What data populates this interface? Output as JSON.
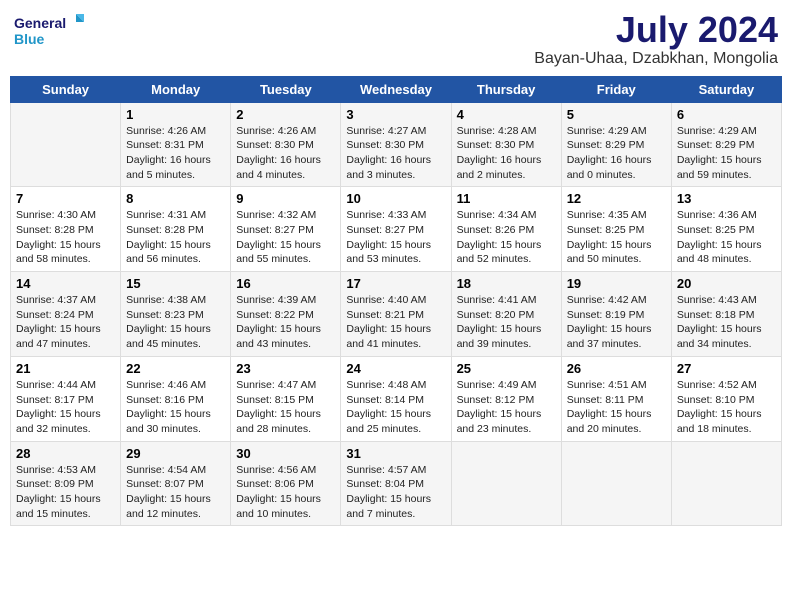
{
  "header": {
    "logo_line1": "General",
    "logo_line2": "Blue",
    "month_year": "July 2024",
    "location": "Bayan-Uhaa, Dzabkhan, Mongolia"
  },
  "weekdays": [
    "Sunday",
    "Monday",
    "Tuesday",
    "Wednesday",
    "Thursday",
    "Friday",
    "Saturday"
  ],
  "weeks": [
    [
      {
        "day": "",
        "info": ""
      },
      {
        "day": "1",
        "info": "Sunrise: 4:26 AM\nSunset: 8:31 PM\nDaylight: 16 hours\nand 5 minutes."
      },
      {
        "day": "2",
        "info": "Sunrise: 4:26 AM\nSunset: 8:30 PM\nDaylight: 16 hours\nand 4 minutes."
      },
      {
        "day": "3",
        "info": "Sunrise: 4:27 AM\nSunset: 8:30 PM\nDaylight: 16 hours\nand 3 minutes."
      },
      {
        "day": "4",
        "info": "Sunrise: 4:28 AM\nSunset: 8:30 PM\nDaylight: 16 hours\nand 2 minutes."
      },
      {
        "day": "5",
        "info": "Sunrise: 4:29 AM\nSunset: 8:29 PM\nDaylight: 16 hours\nand 0 minutes."
      },
      {
        "day": "6",
        "info": "Sunrise: 4:29 AM\nSunset: 8:29 PM\nDaylight: 15 hours\nand 59 minutes."
      }
    ],
    [
      {
        "day": "7",
        "info": "Sunrise: 4:30 AM\nSunset: 8:28 PM\nDaylight: 15 hours\nand 58 minutes."
      },
      {
        "day": "8",
        "info": "Sunrise: 4:31 AM\nSunset: 8:28 PM\nDaylight: 15 hours\nand 56 minutes."
      },
      {
        "day": "9",
        "info": "Sunrise: 4:32 AM\nSunset: 8:27 PM\nDaylight: 15 hours\nand 55 minutes."
      },
      {
        "day": "10",
        "info": "Sunrise: 4:33 AM\nSunset: 8:27 PM\nDaylight: 15 hours\nand 53 minutes."
      },
      {
        "day": "11",
        "info": "Sunrise: 4:34 AM\nSunset: 8:26 PM\nDaylight: 15 hours\nand 52 minutes."
      },
      {
        "day": "12",
        "info": "Sunrise: 4:35 AM\nSunset: 8:25 PM\nDaylight: 15 hours\nand 50 minutes."
      },
      {
        "day": "13",
        "info": "Sunrise: 4:36 AM\nSunset: 8:25 PM\nDaylight: 15 hours\nand 48 minutes."
      }
    ],
    [
      {
        "day": "14",
        "info": "Sunrise: 4:37 AM\nSunset: 8:24 PM\nDaylight: 15 hours\nand 47 minutes."
      },
      {
        "day": "15",
        "info": "Sunrise: 4:38 AM\nSunset: 8:23 PM\nDaylight: 15 hours\nand 45 minutes."
      },
      {
        "day": "16",
        "info": "Sunrise: 4:39 AM\nSunset: 8:22 PM\nDaylight: 15 hours\nand 43 minutes."
      },
      {
        "day": "17",
        "info": "Sunrise: 4:40 AM\nSunset: 8:21 PM\nDaylight: 15 hours\nand 41 minutes."
      },
      {
        "day": "18",
        "info": "Sunrise: 4:41 AM\nSunset: 8:20 PM\nDaylight: 15 hours\nand 39 minutes."
      },
      {
        "day": "19",
        "info": "Sunrise: 4:42 AM\nSunset: 8:19 PM\nDaylight: 15 hours\nand 37 minutes."
      },
      {
        "day": "20",
        "info": "Sunrise: 4:43 AM\nSunset: 8:18 PM\nDaylight: 15 hours\nand 34 minutes."
      }
    ],
    [
      {
        "day": "21",
        "info": "Sunrise: 4:44 AM\nSunset: 8:17 PM\nDaylight: 15 hours\nand 32 minutes."
      },
      {
        "day": "22",
        "info": "Sunrise: 4:46 AM\nSunset: 8:16 PM\nDaylight: 15 hours\nand 30 minutes."
      },
      {
        "day": "23",
        "info": "Sunrise: 4:47 AM\nSunset: 8:15 PM\nDaylight: 15 hours\nand 28 minutes."
      },
      {
        "day": "24",
        "info": "Sunrise: 4:48 AM\nSunset: 8:14 PM\nDaylight: 15 hours\nand 25 minutes."
      },
      {
        "day": "25",
        "info": "Sunrise: 4:49 AM\nSunset: 8:12 PM\nDaylight: 15 hours\nand 23 minutes."
      },
      {
        "day": "26",
        "info": "Sunrise: 4:51 AM\nSunset: 8:11 PM\nDaylight: 15 hours\nand 20 minutes."
      },
      {
        "day": "27",
        "info": "Sunrise: 4:52 AM\nSunset: 8:10 PM\nDaylight: 15 hours\nand 18 minutes."
      }
    ],
    [
      {
        "day": "28",
        "info": "Sunrise: 4:53 AM\nSunset: 8:09 PM\nDaylight: 15 hours\nand 15 minutes."
      },
      {
        "day": "29",
        "info": "Sunrise: 4:54 AM\nSunset: 8:07 PM\nDaylight: 15 hours\nand 12 minutes."
      },
      {
        "day": "30",
        "info": "Sunrise: 4:56 AM\nSunset: 8:06 PM\nDaylight: 15 hours\nand 10 minutes."
      },
      {
        "day": "31",
        "info": "Sunrise: 4:57 AM\nSunset: 8:04 PM\nDaylight: 15 hours\nand 7 minutes."
      },
      {
        "day": "",
        "info": ""
      },
      {
        "day": "",
        "info": ""
      },
      {
        "day": "",
        "info": ""
      }
    ]
  ]
}
